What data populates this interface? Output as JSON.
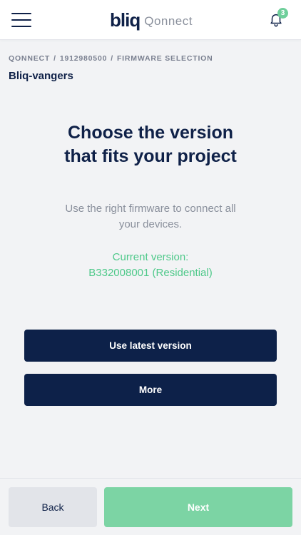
{
  "header": {
    "logo_mark": "bliq",
    "logo_sub": "Qonnect",
    "notification_count": "3"
  },
  "breadcrumb": {
    "items": [
      "QONNECT",
      "1912980500",
      "FIRMWARE SELECTION"
    ],
    "separator": "/"
  },
  "page": {
    "title": "Bliq-vangers"
  },
  "hero": {
    "title_line1": "Choose the version",
    "title_line2": "that fits your project",
    "description_line1": "Use the right firmware to connect all",
    "description_line2": "your devices.",
    "current_version_label": "Current version:",
    "current_version_value": "B332008001 (Residential)"
  },
  "actions": {
    "latest_label": "Use latest version",
    "more_label": "More"
  },
  "footer": {
    "back_label": "Back",
    "next_label": "Next"
  },
  "colors": {
    "navy": "#0d2149",
    "green": "#4fc98a",
    "next_button": "#7cd4a4",
    "background": "#f2f3f5"
  },
  "icons": {
    "menu": "hamburger-icon",
    "notifications": "bell-icon"
  }
}
